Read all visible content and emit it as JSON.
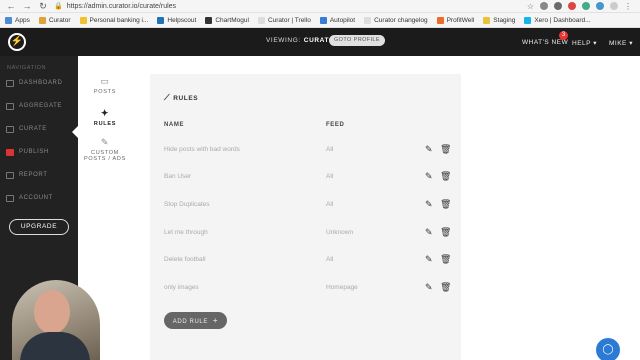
{
  "browser": {
    "url": "https://admin.curator.io/curate/rules",
    "bookmarks": [
      "Apps",
      "Curator",
      "Personal banking i...",
      "Helpscout",
      "ChartMogul",
      "Curator | Trello",
      "Autopilot",
      "Curator changelog",
      "ProfitWell",
      "Staging",
      "Xero | Dashboard..."
    ]
  },
  "header": {
    "viewing_label": "VIEWING:",
    "viewing_value": "CURATOR",
    "goto_profile": "GOTO PROFILE",
    "whats_new": "WHAT'S NEW",
    "whats_new_count": "3",
    "help": "HELP",
    "user": "MIKE"
  },
  "sidebar": {
    "section_label": "NAVIGATION",
    "items": [
      "DASHBOARD",
      "AGGREGATE",
      "CURATE",
      "PUBLISH",
      "REPORT",
      "ACCOUNT"
    ],
    "upgrade": "UPGRADE"
  },
  "submenu": {
    "items": [
      "POSTS",
      "RULES",
      "CUSTOM",
      "POSTS / ADS"
    ]
  },
  "rules": {
    "title": "RULES",
    "columns": {
      "name": "NAME",
      "feed": "FEED"
    },
    "rows": [
      {
        "name": "Hide posts with bad words",
        "feed": "All"
      },
      {
        "name": "Ban User",
        "feed": "All"
      },
      {
        "name": "Stop Duplicates",
        "feed": "All"
      },
      {
        "name": "Let me through",
        "feed": "Unknown"
      },
      {
        "name": "Delete football",
        "feed": "All"
      },
      {
        "name": "only images",
        "feed": "Homepage"
      }
    ],
    "add_button": "ADD RULE"
  },
  "colors": {
    "header_bg": "#1b1b1b",
    "sidebar_bg": "#222222",
    "panel_bg": "#f4f4f4",
    "help_fab": "#2b7bd6",
    "badge": "#ee3333"
  }
}
